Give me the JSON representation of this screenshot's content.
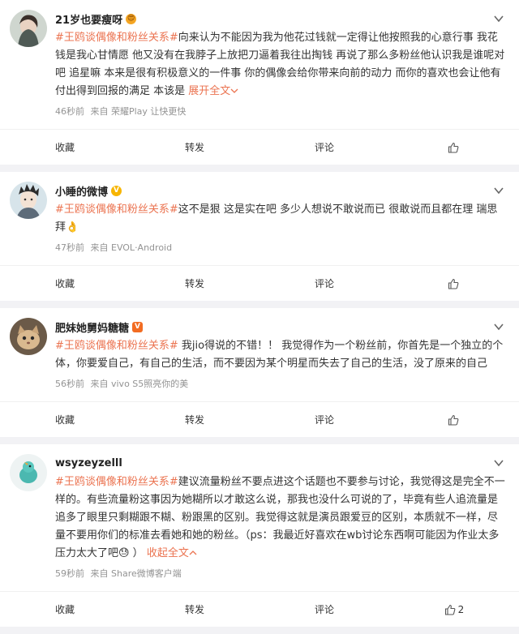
{
  "posts": [
    {
      "username": "21岁也要瘦呀",
      "badge": "😍",
      "topic": "#王鸥谈偶像和粉丝关系#",
      "text": "向来认为不能因为我为他花过钱就一定得让他按照我的心意行事 我花钱是我心甘情愿 他又没有在我脖子上放把刀逼着我往出掏钱 再说了那么多粉丝他认识我是谁呢对吧 追星嘛 本来是很有积极意义的一件事 你的偶像会给你带来向前的动力 而你的喜欢也会让他有付出得到回报的满足 本该是 ",
      "expand": "展开全文",
      "time": "46秒前",
      "source": "来自 荣耀Play 让快更快",
      "actions": [
        "收藏",
        "转发",
        "评论",
        ""
      ]
    },
    {
      "username": "小睡的微博",
      "badge": "V",
      "topic": "#王鸥谈偶像和粉丝关系#",
      "text": "这不是狠 这是实在吧 多少人想说不敢说而已 很敢说而且都在理 瑞思拜👌",
      "expand": "",
      "time": "47秒前",
      "source": "来自 EVOL·Android",
      "actions": [
        "收藏",
        "转发",
        "评论",
        ""
      ]
    },
    {
      "username": "肥妹她舅妈糖糖",
      "badge": "V",
      "topic": "#王鸥谈偶像和粉丝关系#",
      "text": " 我jio得说的不错！！ 我觉得作为一个粉丝前，你首先是一个独立的个体，你要爱自己，有自己的生活，而不要因为某个明星而失去了自己的生活，没了原来的自己",
      "expand": "",
      "time": "56秒前",
      "source": "来自 vivo S5照亮你的美",
      "actions": [
        "收藏",
        "转发",
        "评论",
        ""
      ]
    },
    {
      "username": "wsyzeyzelll",
      "badge": "",
      "topic": "#王鸥谈偶像和粉丝关系#",
      "text": "建议流量粉丝不要点进这个话题也不要参与讨论，我觉得这是完全不一样的。有些流量粉这事因为她糊所以才敢这么说，那我也没什么可说的了，毕竟有些人追流量是追多了眼里只剩糊跟不糊、粉跟黑的区别。我觉得这就是演员跟爱豆的区别，本质就不一样，尽量不要用你们的标准去看她和她的粉丝。（ps：我最近好喜欢在wb讨论东西啊可能因为作业太多压力太大了吧😓 ）",
      "expand": "收起全文",
      "time": "59秒前",
      "source": "来自 Share微博客户端",
      "actions": [
        "收藏",
        "转发",
        "评论",
        "2"
      ]
    }
  ],
  "colors": {
    "topic": "#eb7350",
    "meta": "#939393",
    "page_bg": "#f2f2f5"
  }
}
